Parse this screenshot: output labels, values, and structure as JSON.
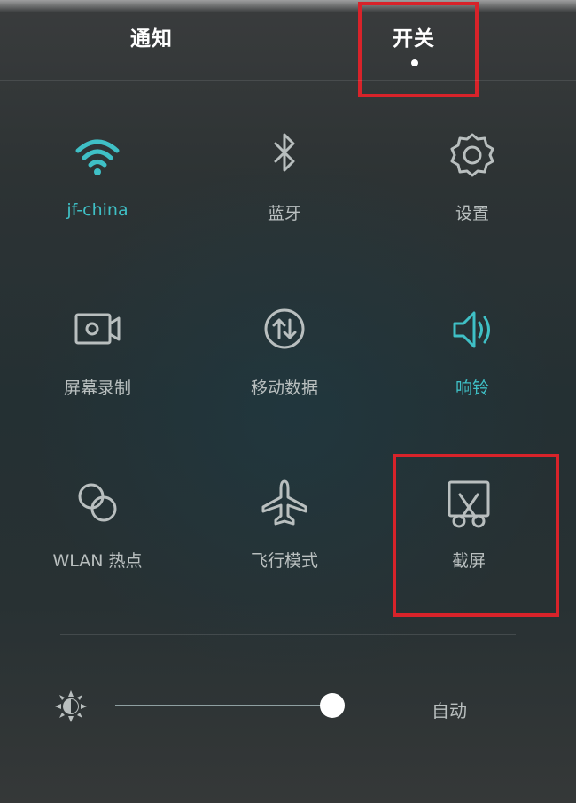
{
  "tabs": {
    "notify_label": "通知",
    "switch_label": "开关"
  },
  "tiles": {
    "wifi": {
      "label": "jf-china",
      "icon": "wifi-icon",
      "active": true
    },
    "bluetooth": {
      "label": "蓝牙",
      "icon": "bluetooth-icon",
      "active": false
    },
    "settings": {
      "label": "设置",
      "icon": "gear-icon",
      "active": false
    },
    "screen_record": {
      "label": "屏幕录制",
      "icon": "video-camera-icon",
      "active": false
    },
    "mobile_data": {
      "label": "移动数据",
      "icon": "data-arrows-icon",
      "active": false
    },
    "ringer": {
      "label": "响铃",
      "icon": "speaker-icon",
      "active": true
    },
    "hotspot": {
      "label": "WLAN 热点",
      "icon": "hotspot-icon",
      "active": false
    },
    "airplane": {
      "label": "飞行模式",
      "icon": "airplane-icon",
      "active": false
    },
    "screenshot": {
      "label": "截屏",
      "icon": "screenshot-scissors-icon",
      "active": false
    }
  },
  "brightness": {
    "icon": "brightness-icon",
    "level": 0.97,
    "auto_label": "自动"
  },
  "colors": {
    "accent": "#3fc0c6",
    "inactive": "#b9bfbf",
    "highlight_box": "#d8232a"
  }
}
